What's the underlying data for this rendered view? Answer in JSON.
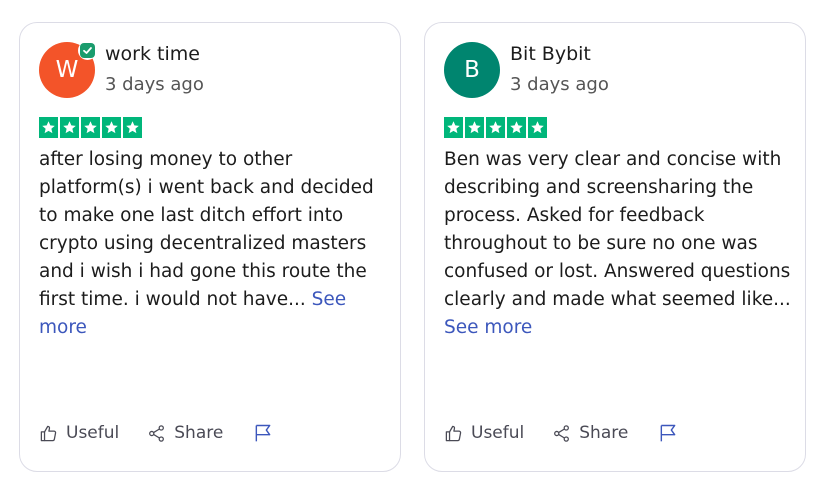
{
  "colors": {
    "trustpilot_green": "#00b67a",
    "link_blue": "#3c57bc",
    "avatar_orange": "#f35429",
    "avatar_teal": "#00856f",
    "verified_green": "#1a9c6d"
  },
  "icons": {
    "star": "star-icon",
    "verified": "verified-check-icon",
    "useful": "thumbs-up-icon",
    "share": "share-icon",
    "flag": "flag-icon"
  },
  "reviews": [
    {
      "avatar_initial": "W",
      "avatar_color": "#f35429",
      "verified": true,
      "name": "work time",
      "date": "3 days ago",
      "rating": 5,
      "text": "after losing money to other platform(s) i went back and decided to make one last ditch effort into crypto using decentralized masters and i wish i had gone this route the first time. i would not have...",
      "see_more": "See more",
      "useful_label": "Useful",
      "share_label": "Share"
    },
    {
      "avatar_initial": "B",
      "avatar_color": "#00856f",
      "verified": false,
      "name": "Bit Bybit",
      "date": "3 days ago",
      "rating": 5,
      "text": "Ben was very clear and concise with describing and screensharing the process. Asked for feedback throughout to be sure no one was confused or lost. Answered questions clearly and made what seemed like...",
      "see_more": "See more",
      "useful_label": "Useful",
      "share_label": "Share"
    }
  ]
}
